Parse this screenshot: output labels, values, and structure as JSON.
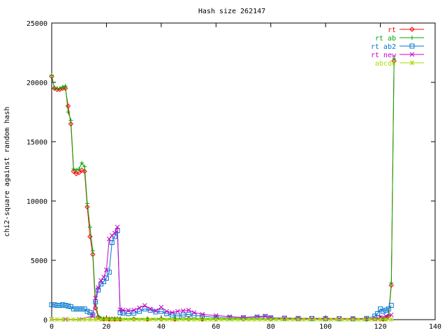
{
  "chart_data": {
    "type": "line",
    "title": "Hash size 262147",
    "xlabel": "",
    "ylabel": "chi2-square against random hash",
    "xlim": [
      0,
      140
    ],
    "ylim": [
      0,
      25000
    ],
    "xticks": [
      0,
      20,
      40,
      60,
      80,
      100,
      120,
      140
    ],
    "yticks": [
      0,
      5000,
      10000,
      15000,
      20000,
      25000
    ],
    "grid": false,
    "legend_position": "top-right",
    "series": [
      {
        "name": "rt",
        "color": "#ff0000",
        "marker": "diamond",
        "x": [
          0,
          1,
          2,
          3,
          4,
          5,
          6,
          7,
          8,
          9,
          10,
          11,
          12,
          13,
          14,
          15,
          16,
          17,
          18,
          19,
          20,
          21,
          22,
          23,
          24,
          25,
          30,
          35,
          40,
          45,
          50,
          55,
          60,
          70,
          80,
          90,
          100,
          110,
          115,
          118,
          120,
          121,
          122,
          123,
          124,
          125
        ],
        "y": [
          20500,
          19500,
          19400,
          19400,
          19500,
          19500,
          18000,
          16500,
          12500,
          12300,
          12400,
          12600,
          12500,
          9500,
          7000,
          5500,
          1000,
          200,
          60,
          60,
          60,
          50,
          50,
          50,
          50,
          50,
          50,
          50,
          50,
          50,
          50,
          50,
          50,
          50,
          50,
          50,
          50,
          50,
          50,
          50,
          50,
          50,
          50,
          300,
          2900,
          21800
        ]
      },
      {
        "name": "rt ab",
        "color": "#00aa00",
        "marker": "plus",
        "x": [
          0,
          1,
          2,
          3,
          4,
          5,
          6,
          7,
          8,
          9,
          10,
          11,
          12,
          13,
          14,
          15,
          16,
          17,
          18,
          19,
          20,
          21,
          22,
          23,
          24,
          25,
          30,
          35,
          40,
          45,
          50,
          55,
          60,
          70,
          80,
          90,
          100,
          110,
          115,
          118,
          120,
          121,
          122,
          123,
          124,
          125
        ],
        "y": [
          20600,
          19500,
          19500,
          19500,
          19600,
          19700,
          17500,
          16800,
          12700,
          12600,
          12700,
          13200,
          12900,
          9800,
          7800,
          5800,
          1500,
          300,
          80,
          80,
          80,
          70,
          70,
          70,
          70,
          70,
          70,
          70,
          70,
          70,
          70,
          70,
          70,
          70,
          70,
          70,
          70,
          70,
          70,
          70,
          70,
          70,
          70,
          400,
          3100,
          22000
        ]
      },
      {
        "name": "rt ab2",
        "color": "#0077cc",
        "marker": "square",
        "x": [
          0,
          1,
          2,
          3,
          4,
          5,
          6,
          7,
          8,
          9,
          10,
          11,
          12,
          13,
          14,
          15,
          16,
          17,
          18,
          19,
          20,
          21,
          22,
          23,
          24,
          25,
          26,
          28,
          30,
          32,
          34,
          36,
          38,
          40,
          42,
          44,
          46,
          48,
          50,
          52,
          55,
          60,
          65,
          70,
          75,
          78,
          80,
          85,
          90,
          95,
          100,
          105,
          110,
          115,
          118,
          119,
          120,
          121,
          122,
          123,
          124
        ],
        "y": [
          1250,
          1250,
          1200,
          1200,
          1250,
          1200,
          1150,
          1100,
          900,
          900,
          900,
          900,
          900,
          700,
          600,
          400,
          1500,
          2500,
          3000,
          3200,
          3500,
          4000,
          6500,
          7000,
          7500,
          600,
          550,
          500,
          550,
          700,
          900,
          800,
          650,
          700,
          500,
          400,
          300,
          400,
          450,
          350,
          300,
          200,
          150,
          150,
          200,
          250,
          150,
          120,
          100,
          100,
          80,
          80,
          70,
          100,
          300,
          500,
          900,
          700,
          800,
          900,
          1200
        ]
      },
      {
        "name": "rt new",
        "color": "#cc00cc",
        "marker": "cross",
        "x": [
          0,
          5,
          10,
          15,
          16,
          17,
          18,
          19,
          20,
          21,
          22,
          23,
          24,
          25,
          26,
          28,
          30,
          32,
          34,
          36,
          38,
          40,
          42,
          44,
          46,
          48,
          50,
          52,
          55,
          60,
          65,
          70,
          75,
          78,
          80,
          85,
          90,
          95,
          100,
          105,
          110,
          115,
          118,
          120,
          122,
          124
        ],
        "y": [
          30,
          30,
          30,
          300,
          1800,
          2700,
          3300,
          3600,
          4200,
          6800,
          7100,
          7300,
          7800,
          850,
          800,
          780,
          800,
          1000,
          1200,
          900,
          750,
          1050,
          700,
          600,
          700,
          750,
          800,
          600,
          450,
          350,
          250,
          200,
          250,
          300,
          150,
          150,
          100,
          100,
          100,
          80,
          80,
          70,
          80,
          200,
          300,
          400
        ]
      },
      {
        "name": "abcde",
        "color": "#aadd00",
        "marker": "star",
        "x": [
          0,
          2,
          4,
          6,
          8,
          10,
          12,
          14,
          16,
          18,
          20,
          22,
          24,
          26,
          28,
          30,
          32,
          34,
          36,
          38,
          40,
          42,
          44,
          46,
          48,
          50,
          52,
          54,
          56,
          58,
          60,
          62,
          64,
          66,
          68,
          70,
          72,
          74,
          76,
          78,
          80,
          82,
          84,
          86,
          88,
          90,
          92,
          94,
          96,
          98,
          100,
          102,
          104,
          106,
          108,
          110,
          112,
          114,
          116,
          118,
          120,
          122,
          124
        ],
        "y": [
          10,
          10,
          10,
          10,
          10,
          10,
          10,
          10,
          10,
          10,
          10,
          10,
          10,
          10,
          10,
          10,
          10,
          10,
          10,
          10,
          10,
          10,
          10,
          10,
          10,
          10,
          10,
          10,
          10,
          10,
          10,
          10,
          10,
          10,
          10,
          10,
          10,
          10,
          10,
          10,
          10,
          10,
          10,
          10,
          10,
          10,
          10,
          10,
          10,
          10,
          10,
          10,
          10,
          10,
          10,
          10,
          10,
          10,
          10,
          10,
          10,
          10,
          10
        ]
      }
    ]
  }
}
